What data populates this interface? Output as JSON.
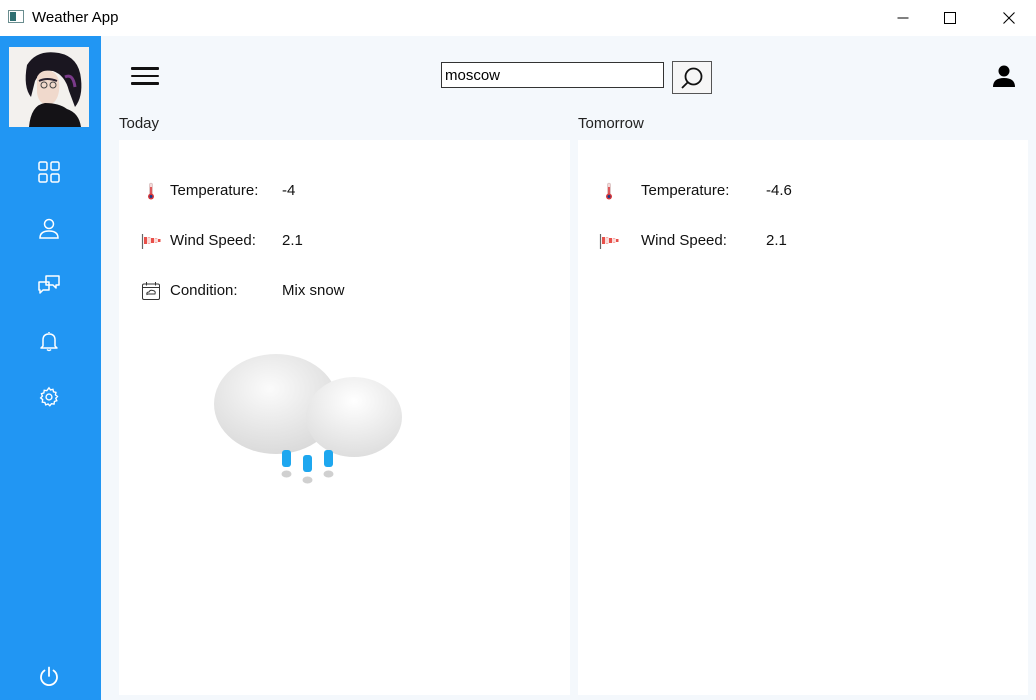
{
  "window": {
    "title": "Weather App",
    "controls": [
      "minimize-icon",
      "maximize-icon",
      "close-icon"
    ]
  },
  "sidebar": {
    "color": "#2196f3",
    "items": [
      {
        "icon": "dashboard-grid-icon"
      },
      {
        "icon": "user-outline-icon"
      },
      {
        "icon": "chat-bubbles-icon"
      },
      {
        "icon": "bell-icon"
      },
      {
        "icon": "gear-icon"
      }
    ],
    "footer_icon": "power-icon"
  },
  "header": {
    "search_value": "moscow",
    "search_icon": "search-icon",
    "menu_icon": "hamburger-menu-icon",
    "account_icon": "account-icon"
  },
  "today": {
    "label": "Today",
    "temperature_label": "Temperature:",
    "temperature_value": "-4",
    "wind_label": "Wind Speed:",
    "wind_value": "2.1",
    "condition_label": "Condition:",
    "condition_value": "Mix snow",
    "condition_image": "cloud-sleet-icon"
  },
  "tomorrow": {
    "label": "Tomorrow",
    "temperature_label": "Temperature:",
    "temperature_value": "-4.6",
    "wind_label": "Wind Speed:",
    "wind_value": "2.1"
  }
}
